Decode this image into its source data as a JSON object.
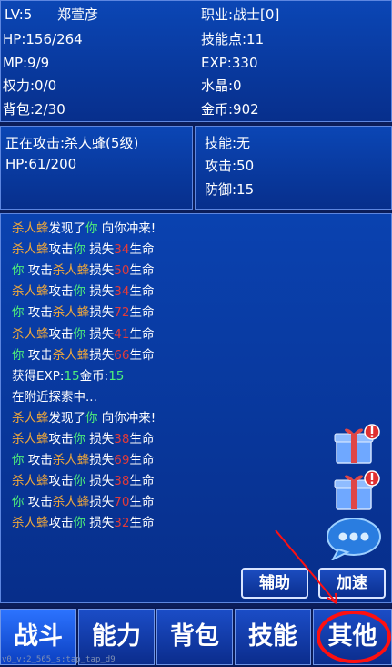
{
  "player": {
    "level": "LV:5",
    "name": "郑萱彦",
    "job": "职业:战士[0]",
    "hp": "HP:156/264",
    "skill_points": "技能点:11",
    "mp": "MP:9/9",
    "exp": "EXP:330",
    "power": "权力:0/0",
    "crystal": "水晶:0",
    "bag": "背包:2/30",
    "gold": "金币:902"
  },
  "enemy": {
    "attacking": "正在攻击:杀人蜂(5级)",
    "hp": "HP:61/200",
    "skill": "技能:无",
    "attack": "攻击:50",
    "defense": "防御:15"
  },
  "log": [
    {
      "parts": [
        {
          "t": "杀人蜂",
          "c": "enemy"
        },
        {
          "t": "发现了",
          "c": "white"
        },
        {
          "t": "你",
          "c": "you"
        },
        {
          "t": " 向你冲来!",
          "c": "white"
        }
      ]
    },
    {
      "parts": [
        {
          "t": "杀人蜂",
          "c": "enemy"
        },
        {
          "t": "攻击",
          "c": "white"
        },
        {
          "t": "你",
          "c": "you"
        },
        {
          "t": " 损失",
          "c": "white"
        },
        {
          "t": "34",
          "c": "dmg"
        },
        {
          "t": "生命",
          "c": "white"
        }
      ]
    },
    {
      "parts": [
        {
          "t": "你",
          "c": "you"
        },
        {
          "t": " 攻击",
          "c": "white"
        },
        {
          "t": "杀人蜂",
          "c": "enemy"
        },
        {
          "t": "损失",
          "c": "white"
        },
        {
          "t": "50",
          "c": "dmg"
        },
        {
          "t": "生命",
          "c": "white"
        }
      ]
    },
    {
      "parts": [
        {
          "t": "杀人蜂",
          "c": "enemy"
        },
        {
          "t": "攻击",
          "c": "white"
        },
        {
          "t": "你",
          "c": "you"
        },
        {
          "t": " 损失",
          "c": "white"
        },
        {
          "t": "34",
          "c": "dmg"
        },
        {
          "t": "生命",
          "c": "white"
        }
      ]
    },
    {
      "parts": [
        {
          "t": "你",
          "c": "you"
        },
        {
          "t": " 攻击",
          "c": "white"
        },
        {
          "t": "杀人蜂",
          "c": "enemy"
        },
        {
          "t": "损失",
          "c": "white"
        },
        {
          "t": "72",
          "c": "dmg"
        },
        {
          "t": "生命",
          "c": "white"
        }
      ]
    },
    {
      "parts": [
        {
          "t": "杀人蜂",
          "c": "enemy"
        },
        {
          "t": "攻击",
          "c": "white"
        },
        {
          "t": "你",
          "c": "you"
        },
        {
          "t": " 损失",
          "c": "white"
        },
        {
          "t": "41",
          "c": "dmg"
        },
        {
          "t": "生命",
          "c": "white"
        }
      ]
    },
    {
      "parts": [
        {
          "t": "你",
          "c": "you"
        },
        {
          "t": " 攻击",
          "c": "white"
        },
        {
          "t": "杀人蜂",
          "c": "enemy"
        },
        {
          "t": "损失",
          "c": "white"
        },
        {
          "t": "66",
          "c": "dmg"
        },
        {
          "t": "生命",
          "c": "white"
        }
      ]
    },
    {
      "parts": [
        {
          "t": "获得EXP:",
          "c": "white"
        },
        {
          "t": "15",
          "c": "num"
        },
        {
          "t": "金币:",
          "c": "white"
        },
        {
          "t": "15",
          "c": "num"
        }
      ]
    },
    {
      "parts": [
        {
          "t": "在附近探索中...",
          "c": "white"
        }
      ]
    },
    {
      "parts": [
        {
          "t": "杀人蜂",
          "c": "enemy"
        },
        {
          "t": "发现了",
          "c": "white"
        },
        {
          "t": "你",
          "c": "you"
        },
        {
          "t": " 向你冲来!",
          "c": "white"
        }
      ]
    },
    {
      "parts": [
        {
          "t": "杀人蜂",
          "c": "enemy"
        },
        {
          "t": "攻击",
          "c": "white"
        },
        {
          "t": "你",
          "c": "you"
        },
        {
          "t": " 损失",
          "c": "white"
        },
        {
          "t": "38",
          "c": "dmg"
        },
        {
          "t": "生命",
          "c": "white"
        }
      ]
    },
    {
      "parts": [
        {
          "t": "你",
          "c": "you"
        },
        {
          "t": " 攻击",
          "c": "white"
        },
        {
          "t": "杀人蜂",
          "c": "enemy"
        },
        {
          "t": "损失",
          "c": "white"
        },
        {
          "t": "69",
          "c": "dmg"
        },
        {
          "t": "生命",
          "c": "white"
        }
      ]
    },
    {
      "parts": [
        {
          "t": "杀人蜂",
          "c": "enemy"
        },
        {
          "t": "攻击",
          "c": "white"
        },
        {
          "t": "你",
          "c": "you"
        },
        {
          "t": " 损失",
          "c": "white"
        },
        {
          "t": "38",
          "c": "dmg"
        },
        {
          "t": "生命",
          "c": "white"
        }
      ]
    },
    {
      "parts": [
        {
          "t": "你",
          "c": "you"
        },
        {
          "t": " 攻击",
          "c": "white"
        },
        {
          "t": "杀人蜂",
          "c": "enemy"
        },
        {
          "t": "损失",
          "c": "white"
        },
        {
          "t": "70",
          "c": "dmg"
        },
        {
          "t": "生命",
          "c": "white"
        }
      ]
    },
    {
      "parts": [
        {
          "t": "杀人蜂",
          "c": "enemy"
        },
        {
          "t": "攻击",
          "c": "white"
        },
        {
          "t": "你",
          "c": "you"
        },
        {
          "t": " 损失",
          "c": "white"
        },
        {
          "t": "32",
          "c": "dmg"
        },
        {
          "t": "生命",
          "c": "white"
        }
      ]
    }
  ],
  "buttons": {
    "assist": "辅助",
    "speed": "加速"
  },
  "tabs": [
    {
      "label": "战斗"
    },
    {
      "label": "能力"
    },
    {
      "label": "背包"
    },
    {
      "label": "技能"
    },
    {
      "label": "其他"
    }
  ],
  "icons": [
    "gift-box-alert-icon",
    "gift-box-alert-icon",
    "chat-bubble-icon"
  ],
  "debug": "v0_v:2_565_s:tap_tap_d9",
  "colors": {
    "enemy": "#f0a83a",
    "you": "#4ff07a",
    "damage": "#e03b3b",
    "panel": "#0b46b5",
    "highlight": "#ff1010"
  }
}
